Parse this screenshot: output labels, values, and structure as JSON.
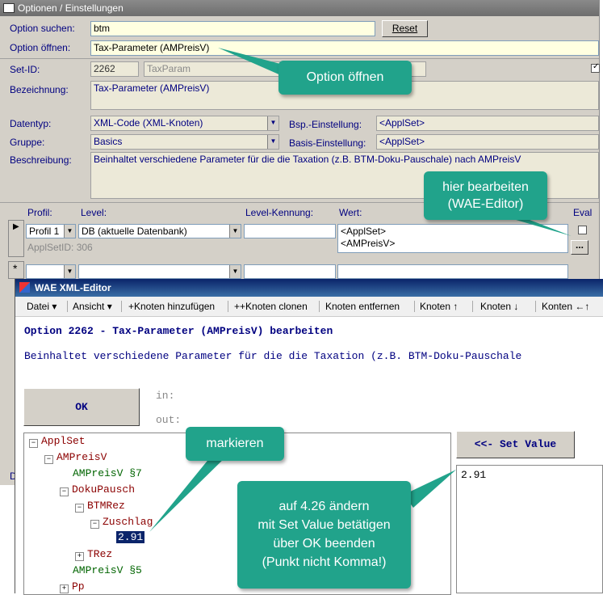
{
  "window": {
    "title": "Optionen / Einstellungen"
  },
  "search": {
    "label": "Option suchen:",
    "value": "btm",
    "reset_label": "Reset"
  },
  "open": {
    "label": "Option öffnen:",
    "value": "Tax-Parameter (AMPreisV)"
  },
  "setid": {
    "label": "Set-ID:",
    "value": "2262",
    "param": "TaxParam"
  },
  "bezeichnung": {
    "label": "Bezeichnung:",
    "value": "Tax-Parameter (AMPreisV)"
  },
  "datentyp": {
    "label": "Datentyp:",
    "value": "XML-Code (XML-Knoten)"
  },
  "gruppe": {
    "label": "Gruppe:",
    "value": "Basics"
  },
  "bsp": {
    "label": "Bsp.-Einstellung:",
    "value": "<ApplSet>"
  },
  "basis": {
    "label": "Basis-Einstellung:",
    "value": "<ApplSet>"
  },
  "beschreibung": {
    "label": "Beschreibung:",
    "value": "Beinhaltet verschiedene Parameter für die die Taxation (z.B. BTM-Doku-Pauschale) nach AMPreisV"
  },
  "grid": {
    "headers": {
      "profil": "Profil:",
      "level": "Level:",
      "kennung": "Level-Kennung:",
      "wert": "Wert:",
      "eval": "Eval"
    },
    "row": {
      "profil": "Profil 1",
      "level": "DB  (aktuelle Datenbank)",
      "wert_line1": "<ApplSet>",
      "wert_line2": "<AMPreisV>",
      "applsetid": "ApplSetID:  306",
      "ellipsis": "..."
    },
    "new_row_marker": "*"
  },
  "partial_label": "D",
  "editor": {
    "title": "WAE XML-Editor",
    "menu": [
      "Datei",
      "Ansicht",
      "+Knoten hinzufügen",
      "++Knoten clonen",
      "Knoten entfernen",
      "Knoten",
      "Knoten",
      "Konten"
    ],
    "heading": "Option 2262 - Tax-Parameter (AMPreisV) bearbeiten",
    "description": "Beinhaltet verschiedene Parameter für die die Taxation (z.B. BTM-Doku-Pauschale",
    "ok_label": "OK",
    "in_label": "in:",
    "out_label": "out:",
    "set_value_label": "<<- Set Value",
    "value": "2.91",
    "tree": {
      "root": "ApplSet",
      "ampreisv": "AMPreisV",
      "ampreisv7": "AMPreisV §7",
      "dokupausch": "DokuPausch",
      "btmrez": "BTMRez",
      "zuschlag": "Zuschlag",
      "selected_value": "2.91",
      "trez": "TRez",
      "ampreisv5": "AMPreisV §5",
      "pp": "Pp"
    }
  },
  "callouts": {
    "open": "Option öffnen",
    "edit": "hier bearbeiten\n(WAE-Editor)",
    "mark": "markieren",
    "change": "auf 4.26 ändern\nmit Set Value betätigen\nüber OK beenden\n(Punkt nicht Komma!)"
  },
  "colors": {
    "callout": "#21a38b",
    "label": "#000080",
    "tree_text": "#8b0000",
    "tree_green": "#006400",
    "selection": "#0a246a",
    "editor_text": "#000080"
  }
}
